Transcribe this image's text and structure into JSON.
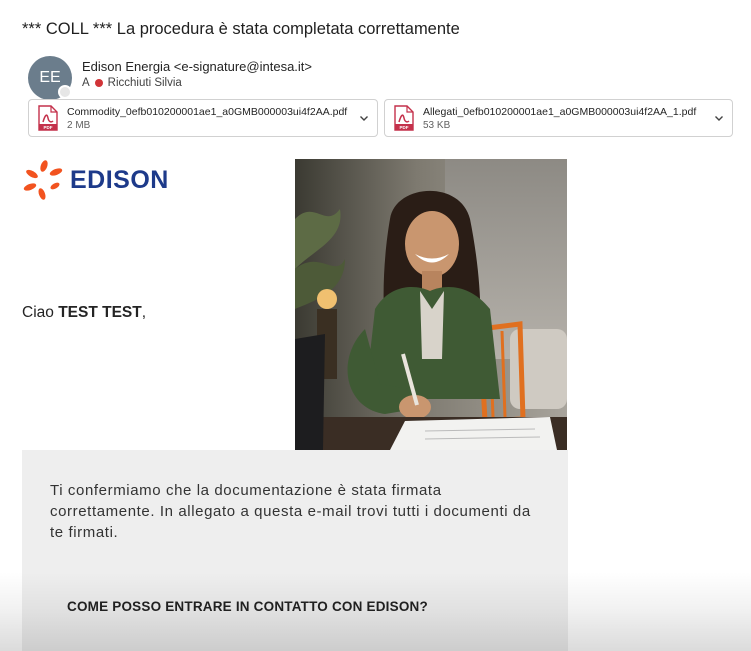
{
  "email": {
    "subject": "*** COLL ***  La procedura è stata completata correttamente",
    "sender": {
      "initials": "EE",
      "display": "Edison Energia <e-signature@intesa.it>",
      "to_label": "A",
      "recipient": "Ricchiuti Silvia"
    },
    "attachments": [
      {
        "name": "Commodity_0efb010200001ae1_a0GMB000003ui4f2AA.pdf",
        "size": "2 MB",
        "icon": "pdf-icon"
      },
      {
        "name": "Allegati_0efb010200001ae1_a0GMB000003ui4f2AA_1.pdf",
        "size": "53 KB",
        "icon": "pdf-icon"
      }
    ]
  },
  "body": {
    "logo_text": "EDISON",
    "greeting_prefix": "Ciao ",
    "greeting_name": "TEST TEST",
    "greeting_suffix": ",",
    "confirmation": "Ti confermiamo che la documentazione è stata firmata correttamente. In allegato a questa e-mail trovi tutti i documenti da te firmati.",
    "contact_heading": "COME POSSO ENTRARE IN CONTATTO CON EDISON?"
  },
  "colors": {
    "brand_orange": "#f2531f",
    "brand_blue": "#1d3a8a",
    "pdf_red": "#c4314b",
    "avatar": "#6b7d8c"
  }
}
